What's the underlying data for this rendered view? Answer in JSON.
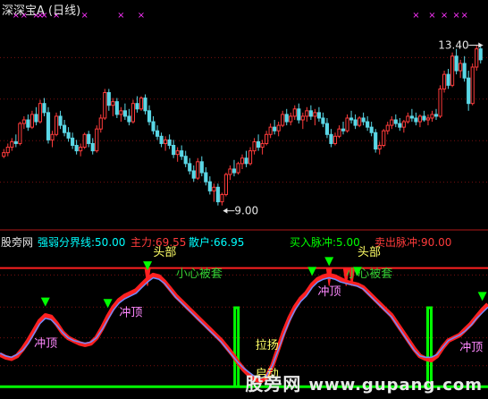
{
  "title": "深深宝A (日线)",
  "indicator_header": {
    "source": "股旁网",
    "items": [
      {
        "label": "强弱分界线:",
        "value": "50.00",
        "color": "#00ffff"
      },
      {
        "label": "主力:",
        "value": "69.55",
        "color": "#ff3b3b"
      },
      {
        "label": "散户:",
        "value": "66.95",
        "color": "#00ffff"
      },
      {
        "label": "买入脉冲:",
        "value": "5.00",
        "color": "#00ff00"
      },
      {
        "label": "卖出脉冲:",
        "value": "90.00",
        "color": "#ff3b3b"
      }
    ]
  },
  "watermark": {
    "text": "股旁网",
    "url": "www.gupang.com"
  },
  "colors": {
    "up": "#ff3b3b",
    "down": "#5ad7e6",
    "main_line": "#ff2020",
    "retail_line": "#6f8cff",
    "buy_pulse": "#00ff00",
    "sell_pulse": "#ff2020",
    "arrow": "#00ff00",
    "label_yellow": "#ffff66",
    "label_pink": "#ff88ff",
    "label_green": "#33cc33",
    "marker": "#ff33ff"
  },
  "chart_data": [
    {
      "type": "candlestick",
      "title": "深深宝A (日线)",
      "ylim": [
        8.5,
        14.2
      ],
      "grid": true,
      "annotations": [
        {
          "text": "13.40",
          "x_index": 119,
          "y": 13.4
        },
        {
          "text": "9.00",
          "x_index": 54,
          "y": 9.0
        }
      ],
      "top_markers_x_index": [
        3,
        5,
        8,
        9,
        10,
        13,
        20,
        29,
        34,
        102,
        106,
        109,
        112,
        114
      ],
      "candles": [
        [
          10.35,
          10.55,
          10.3,
          10.45
        ],
        [
          10.45,
          10.7,
          10.35,
          10.6
        ],
        [
          10.6,
          10.85,
          10.5,
          10.75
        ],
        [
          10.75,
          10.95,
          10.6,
          10.7
        ],
        [
          10.7,
          11.3,
          10.65,
          11.25
        ],
        [
          11.25,
          11.45,
          11.1,
          11.35
        ],
        [
          11.35,
          11.5,
          11.05,
          11.15
        ],
        [
          11.15,
          11.6,
          11.1,
          11.5
        ],
        [
          11.5,
          11.7,
          11.2,
          11.3
        ],
        [
          11.3,
          11.9,
          11.25,
          11.8
        ],
        [
          11.8,
          11.95,
          11.45,
          11.55
        ],
        [
          11.55,
          11.7,
          10.7,
          10.8
        ],
        [
          10.8,
          11.05,
          10.6,
          10.95
        ],
        [
          10.95,
          11.55,
          10.9,
          11.45
        ],
        [
          11.45,
          11.6,
          11.1,
          11.2
        ],
        [
          11.2,
          11.35,
          10.9,
          11.0
        ],
        [
          11.0,
          11.15,
          10.75,
          10.85
        ],
        [
          10.85,
          11.0,
          10.55,
          10.65
        ],
        [
          10.65,
          10.8,
          10.4,
          10.5
        ],
        [
          10.5,
          10.7,
          10.35,
          10.6
        ],
        [
          10.6,
          11.0,
          10.55,
          10.95
        ],
        [
          10.95,
          11.05,
          10.6,
          10.7
        ],
        [
          10.7,
          10.85,
          10.4,
          10.5
        ],
        [
          10.5,
          11.2,
          10.45,
          11.1
        ],
        [
          11.1,
          11.5,
          11.0,
          11.4
        ],
        [
          11.4,
          12.2,
          11.35,
          12.1
        ],
        [
          12.1,
          12.2,
          11.6,
          11.75
        ],
        [
          11.75,
          11.95,
          11.45,
          11.85
        ],
        [
          11.85,
          11.95,
          11.4,
          11.5
        ],
        [
          11.5,
          11.7,
          11.3,
          11.6
        ],
        [
          11.6,
          11.8,
          11.35,
          11.45
        ],
        [
          11.45,
          11.65,
          11.2,
          11.3
        ],
        [
          11.3,
          11.9,
          11.25,
          11.8
        ],
        [
          11.8,
          12.0,
          11.55,
          11.65
        ],
        [
          11.65,
          12.0,
          11.6,
          11.95
        ],
        [
          11.95,
          12.05,
          11.5,
          11.6
        ],
        [
          11.6,
          11.75,
          11.2,
          11.3
        ],
        [
          11.3,
          11.45,
          10.95,
          11.05
        ],
        [
          11.05,
          11.2,
          10.8,
          10.9
        ],
        [
          10.9,
          11.0,
          10.6,
          10.7
        ],
        [
          10.7,
          10.9,
          10.5,
          10.8
        ],
        [
          10.8,
          10.95,
          10.55,
          10.65
        ],
        [
          10.65,
          10.8,
          10.3,
          10.4
        ],
        [
          10.4,
          10.6,
          10.2,
          10.5
        ],
        [
          10.5,
          10.65,
          10.25,
          10.35
        ],
        [
          10.35,
          10.5,
          10.05,
          10.15
        ],
        [
          10.15,
          10.3,
          9.85,
          9.95
        ],
        [
          9.95,
          10.1,
          9.65,
          9.75
        ],
        [
          9.75,
          10.3,
          9.7,
          10.2
        ],
        [
          10.2,
          10.35,
          9.8,
          9.9
        ],
        [
          9.9,
          10.05,
          9.55,
          9.65
        ],
        [
          9.65,
          9.8,
          9.3,
          9.4
        ],
        [
          9.4,
          9.6,
          9.1,
          9.5
        ],
        [
          9.5,
          9.6,
          9.0,
          9.1
        ],
        [
          9.1,
          9.35,
          9.0,
          9.3
        ],
        [
          9.3,
          9.9,
          9.25,
          9.85
        ],
        [
          9.85,
          10.1,
          9.7,
          10.0
        ],
        [
          10.0,
          10.25,
          9.8,
          9.9
        ],
        [
          9.9,
          10.2,
          9.85,
          10.15
        ],
        [
          10.15,
          10.4,
          10.0,
          10.3
        ],
        [
          10.3,
          10.5,
          10.05,
          10.15
        ],
        [
          10.15,
          10.6,
          10.1,
          10.5
        ],
        [
          10.5,
          10.85,
          10.4,
          10.75
        ],
        [
          10.75,
          10.95,
          10.5,
          10.6
        ],
        [
          10.6,
          10.8,
          10.4,
          10.7
        ],
        [
          10.7,
          11.05,
          10.65,
          10.95
        ],
        [
          10.95,
          11.25,
          10.85,
          11.15
        ],
        [
          11.15,
          11.35,
          10.95,
          11.05
        ],
        [
          11.05,
          11.3,
          10.9,
          11.2
        ],
        [
          11.2,
          11.6,
          11.15,
          11.5
        ],
        [
          11.5,
          11.65,
          11.2,
          11.3
        ],
        [
          11.3,
          11.55,
          11.2,
          11.45
        ],
        [
          11.45,
          11.75,
          11.35,
          11.65
        ],
        [
          11.65,
          11.8,
          11.25,
          11.35
        ],
        [
          11.35,
          11.55,
          11.1,
          11.45
        ],
        [
          11.45,
          11.7,
          11.3,
          11.6
        ],
        [
          11.6,
          11.75,
          11.35,
          11.45
        ],
        [
          11.45,
          11.65,
          11.2,
          11.55
        ],
        [
          11.55,
          11.7,
          11.3,
          11.4
        ],
        [
          11.4,
          11.55,
          11.15,
          11.25
        ],
        [
          11.25,
          11.4,
          10.85,
          10.95
        ],
        [
          10.95,
          11.1,
          10.6,
          10.7
        ],
        [
          10.7,
          11.0,
          10.65,
          10.9
        ],
        [
          10.9,
          11.2,
          10.85,
          11.1
        ],
        [
          11.1,
          11.3,
          10.95,
          11.05
        ],
        [
          11.05,
          11.5,
          11.0,
          11.4
        ],
        [
          11.4,
          11.6,
          11.25,
          11.35
        ],
        [
          11.35,
          11.5,
          11.1,
          11.2
        ],
        [
          11.2,
          11.45,
          11.15,
          11.4
        ],
        [
          11.4,
          11.55,
          11.2,
          11.3
        ],
        [
          11.3,
          11.45,
          11.05,
          11.15
        ],
        [
          11.15,
          11.3,
          10.9,
          11.0
        ],
        [
          11.0,
          11.1,
          10.45,
          10.55
        ],
        [
          10.55,
          10.75,
          10.4,
          10.65
        ],
        [
          10.65,
          11.1,
          10.6,
          11.05
        ],
        [
          11.05,
          11.3,
          10.95,
          11.2
        ],
        [
          11.2,
          11.45,
          11.1,
          11.35
        ],
        [
          11.35,
          11.5,
          11.15,
          11.25
        ],
        [
          11.25,
          11.4,
          11.05,
          11.15
        ],
        [
          11.15,
          11.35,
          11.0,
          11.3
        ],
        [
          11.3,
          11.55,
          11.25,
          11.45
        ],
        [
          11.45,
          11.65,
          11.3,
          11.4
        ],
        [
          11.4,
          11.55,
          11.2,
          11.3
        ],
        [
          11.3,
          11.5,
          11.15,
          11.45
        ],
        [
          11.45,
          11.6,
          11.3,
          11.35
        ],
        [
          11.35,
          11.5,
          11.2,
          11.4
        ],
        [
          11.4,
          11.6,
          11.3,
          11.5
        ],
        [
          11.5,
          11.65,
          11.35,
          11.45
        ],
        [
          11.45,
          12.3,
          11.4,
          12.2
        ],
        [
          12.2,
          12.7,
          12.1,
          12.6
        ],
        [
          12.6,
          12.75,
          12.2,
          12.3
        ],
        [
          12.3,
          13.2,
          12.25,
          13.1
        ],
        [
          13.1,
          13.3,
          12.6,
          12.7
        ],
        [
          12.7,
          13.0,
          12.5,
          12.9
        ],
        [
          12.9,
          13.1,
          12.4,
          12.5
        ],
        [
          12.5,
          12.7,
          11.6,
          11.8
        ],
        [
          11.8,
          12.9,
          11.75,
          12.8
        ],
        [
          12.8,
          13.4,
          12.7,
          13.3
        ],
        [
          13.3,
          13.4,
          12.9,
          13.0
        ]
      ]
    },
    {
      "type": "line",
      "series": [
        {
          "name": "主力",
          "values": [
            28,
            26,
            25,
            27,
            32,
            38,
            45,
            52,
            56,
            55,
            50,
            44,
            40,
            38,
            36,
            35,
            36,
            40,
            47,
            55,
            62,
            67,
            70,
            72,
            74,
            78,
            82,
            85,
            84,
            80,
            75,
            70,
            66,
            62,
            58,
            54,
            50,
            46,
            42,
            38,
            33,
            28,
            22,
            17,
            13,
            10,
            9,
            12,
            20,
            32,
            44,
            54,
            62,
            68,
            72,
            78,
            82,
            84,
            85,
            84,
            82,
            80,
            79,
            78,
            76,
            72,
            68,
            64,
            60,
            56,
            50,
            44,
            38,
            32,
            27,
            25,
            24,
            27,
            33,
            38,
            40,
            42,
            46,
            50,
            55,
            60,
            64
          ]
        },
        {
          "name": "散户",
          "values": [
            29,
            27,
            26,
            28,
            31,
            36,
            43,
            50,
            54,
            53,
            49,
            44,
            40,
            38,
            37,
            36,
            37,
            40,
            46,
            53,
            60,
            65,
            68,
            70,
            72,
            76,
            80,
            83,
            82,
            79,
            74,
            69,
            65,
            61,
            57,
            53,
            49,
            45,
            41,
            37,
            32,
            27,
            22,
            18,
            15,
            12,
            11,
            13,
            20,
            31,
            42,
            52,
            60,
            66,
            70,
            76,
            80,
            82,
            83,
            82,
            80,
            79,
            78,
            77,
            75,
            71,
            67,
            63,
            59,
            55,
            49,
            43,
            37,
            31,
            27,
            26,
            26,
            28,
            33,
            38,
            40,
            42,
            45,
            49,
            54,
            58,
            62
          ]
        }
      ],
      "thresholds": [
        {
          "name": "强弱分界线",
          "value": 50
        },
        {
          "name": "买入脉冲",
          "value": 5
        },
        {
          "name": "卖出脉冲",
          "value": 90
        }
      ],
      "ylim": [
        0,
        100
      ],
      "labels": [
        {
          "text": "冲顶",
          "x_index": 6
        },
        {
          "text": "冲顶",
          "x_index": 21
        },
        {
          "text": "头部",
          "x_index": 27
        },
        {
          "text": "小心被套",
          "x_index": 31
        },
        {
          "text": "拉扬",
          "x_index": 45
        },
        {
          "text": "启动",
          "x_index": 45
        },
        {
          "text": "冲顶",
          "x_index": 56
        },
        {
          "text": "小心被套",
          "x_index": 61
        },
        {
          "text": "头部",
          "x_index": 63
        },
        {
          "text": "冲顶",
          "x_index": 81
        }
      ],
      "arrows_x_index": [
        8,
        19,
        26,
        55,
        58,
        63,
        85
      ],
      "buy_pulse_x_index": [
        42,
        76
      ],
      "sell_pulse_x_index": [
        26,
        58,
        61,
        62
      ]
    }
  ]
}
